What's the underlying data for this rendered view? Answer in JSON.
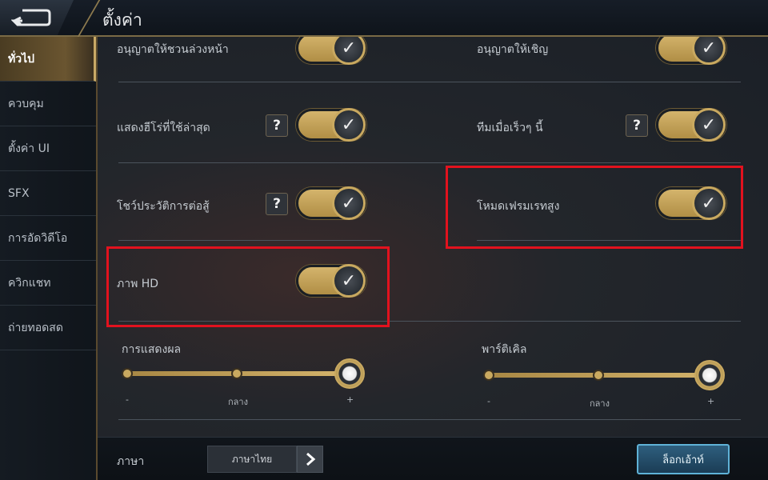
{
  "header": {
    "title": "ตั้งค่า"
  },
  "sidebar": {
    "items": [
      {
        "label": "ทั่วไป"
      },
      {
        "label": "ควบคุม"
      },
      {
        "label": "ตั้งค่า UI"
      },
      {
        "label": "SFX"
      },
      {
        "label": "การอัดวิดีโอ"
      },
      {
        "label": "ควิกแชท"
      },
      {
        "label": "ถ่ายทอดสด"
      }
    ],
    "active_index": 0
  },
  "settings": {
    "row1_left": {
      "label": "อนุญาตให้ชวนล่วงหน้า",
      "checked": true
    },
    "row1_right": {
      "label": "อนุญาตให้เชิญ",
      "checked": true
    },
    "row2_left": {
      "label": "แสดงฮีโร่ที่ใช้ล่าสุด",
      "help": "?",
      "checked": true
    },
    "row2_right": {
      "label": "ทีมเมื่อเร็วๆ นี้",
      "help": "?",
      "checked": true
    },
    "row3_left": {
      "label": "โชว์ประวัติการต่อสู้",
      "help": "?",
      "checked": true
    },
    "row3_right": {
      "label": "โหมดเฟรมเรทสูง",
      "checked": true
    },
    "row4_left": {
      "label": "ภาพ HD",
      "checked": true
    },
    "check_glyph": "✓"
  },
  "sliders": {
    "display": {
      "label": "การแสดงผล",
      "min": "-",
      "mid": "กลาง",
      "max": "+",
      "level": 1.0
    },
    "particles": {
      "label": "พาร์ติเคิล",
      "min": "-",
      "mid": "กลาง",
      "max": "+",
      "level": 1.0
    }
  },
  "footer": {
    "language_label": "ภาษา",
    "language_value": "ภาษาไทย",
    "logout_label": "ล็อกเอ้าท์"
  },
  "icons": {
    "back": "back-arrow-icon",
    "language_next": "chevron-right-icon",
    "check": "checkmark-icon"
  },
  "colors": {
    "accent_gold": "#c9a960",
    "highlight_red": "#e2121e",
    "logout_blue": "#5fb2d7"
  }
}
